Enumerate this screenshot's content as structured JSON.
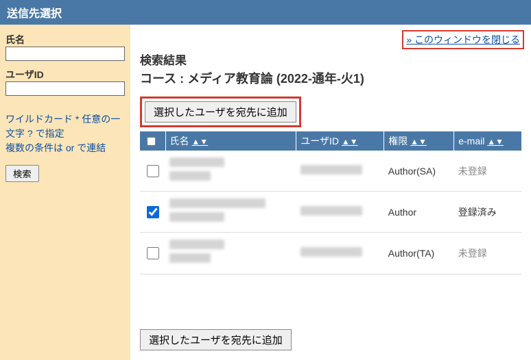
{
  "header": {
    "title": "送信先選択"
  },
  "sidebar": {
    "name_label": "氏名",
    "userid_label": "ユーザID",
    "name_value": "",
    "userid_value": "",
    "help1": "ワイルドカード *   任意の一文字 ? で指定",
    "help2": "複数の条件は or で連結",
    "search_label": "検索"
  },
  "main": {
    "close_label": "» このウィンドウを閉じる",
    "results_heading": "検索結果",
    "course_label": "コース : メディア教育論 (2022-通年-火1)",
    "add_button": "選択したユーザを宛先に追加",
    "columns": {
      "name": "氏名",
      "userid": "ユーザID",
      "role": "権限",
      "email": "e-mail",
      "sort": "▲▼"
    },
    "rows": [
      {
        "checked": false,
        "role": "Author(SA)",
        "email": "未登録"
      },
      {
        "checked": true,
        "role": "Author",
        "email": "登録済み"
      },
      {
        "checked": false,
        "role": "Author(TA)",
        "email": "未登録"
      }
    ]
  }
}
